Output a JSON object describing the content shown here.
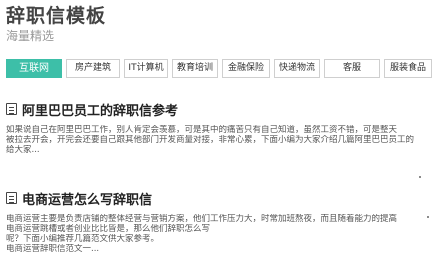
{
  "site": {
    "title": "辞职信模板",
    "subtitle": "海量精选"
  },
  "nav": [
    {
      "label": "互联网",
      "active": true
    },
    {
      "label": "房产建筑",
      "active": false
    },
    {
      "label": "IT计算机",
      "active": false
    },
    {
      "label": "教育培训",
      "active": false
    },
    {
      "label": "金融保险",
      "active": false
    },
    {
      "label": "快递物流",
      "active": false
    },
    {
      "label": "客服",
      "active": false
    },
    {
      "label": "服装食品",
      "active": false
    }
  ],
  "articles": [
    {
      "title": "阿里巴巴员工的辞职信参考",
      "lines": [
        "如果说自己在阿里巴巴工作，别人肯定会羡慕，可是其中的痛苦只有自己知道，虽然工资不错，可是整天",
        "被拉去开会，开完会还要自己跟其他部门开发商量对接，非常心累，下面小编为大家介绍几篇阿里巴巴员工的",
        "给大家..."
      ]
    },
    {
      "title": "电商运营怎么写辞职信",
      "lines": [
        "电商运营主要是负责店铺的整体经营与营销方案，他们工作压力大，时常加班熬夜，而且随着能力的提高",
        "电商运营跳槽或者创业比比皆是，那么他们辞职怎么写",
        "呢？下面小编推荐几篇范文供大家参考。",
        "电商运营辞职信范文一..."
      ]
    }
  ]
}
